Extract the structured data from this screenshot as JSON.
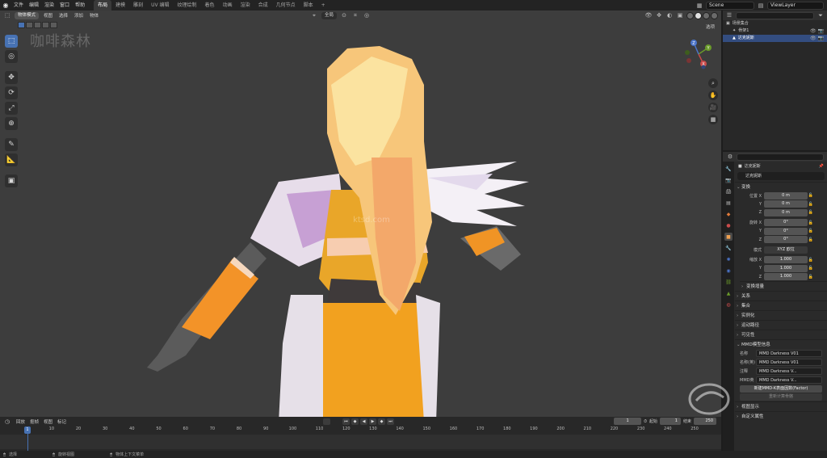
{
  "topbar": {
    "menu": [
      "文件",
      "编辑",
      "渲染",
      "窗口",
      "帮助"
    ],
    "tabs": [
      "布局",
      "建模",
      "雕刻",
      "UV 编辑",
      "纹理绘制",
      "着色",
      "动画",
      "渲染",
      "合成",
      "几何节点",
      "脚本"
    ],
    "active_tab_index": 0,
    "plus": "+",
    "scene": "Scene",
    "view_layer": "ViewLayer"
  },
  "viewport": {
    "mode": "物体模式",
    "menus": [
      "视图",
      "选择",
      "添加",
      "物体"
    ],
    "transform_orientation": "全局",
    "options": "选项",
    "watermark": "咖啡森林",
    "center_watermark": "ktsd.com"
  },
  "toolbar": {
    "tools": [
      "select-box",
      "cursor",
      "move",
      "rotate",
      "scale",
      "transform",
      "annotate",
      "measure",
      "add-cube"
    ]
  },
  "gizmo": {
    "x": "X",
    "y": "Y",
    "z": "Z"
  },
  "outliner": {
    "root": "场景集合",
    "rows": [
      {
        "label": "骨架1",
        "sel": false
      },
      {
        "label": "达克妮斯",
        "sel": true
      }
    ]
  },
  "properties": {
    "object_name": "达克妮斯",
    "data_name": "达克妮斯",
    "transform_title": "变换",
    "location_label": "位置 X",
    "loc": {
      "x": "0 m",
      "y": "0 m",
      "z": "0 m"
    },
    "rotation_label": "旋转 X",
    "rot": {
      "x": "0°",
      "y": "0°",
      "z": "0°"
    },
    "mode_label": "模式",
    "mode_value": "XYZ 欧拉",
    "scale_label": "缩放 X",
    "scale": {
      "x": "1.000",
      "y": "1.000",
      "z": "1.000"
    },
    "delta": "变换增量",
    "axis": {
      "y": "Y",
      "z": "Z"
    },
    "sections": [
      "关系",
      "集合",
      "实例化",
      "运动路径",
      "可见性"
    ],
    "mmd_title": "MMD模型信息",
    "mmd": [
      {
        "k": "名称",
        "v": "MMD Darkness V01"
      },
      {
        "k": "名称(英)",
        "v": "MMD Darkness V01"
      },
      {
        "k": "注释",
        "v": "MMD Darkness V..."
      },
      {
        "k": "MMD英",
        "v": "MMD Darkness V..."
      }
    ],
    "mmd_btn": "新建MMD-K表面因数(Factor)",
    "mmd_btn2": "重新计算骨骼",
    "bottom_sections": [
      "视图显示",
      "自定义属性"
    ]
  },
  "timeline": {
    "menus": [
      "回放",
      "抠帧",
      "视图",
      "标记"
    ],
    "current": "1",
    "start_label": "起始",
    "start": "1",
    "end_label": "结束",
    "end": "250",
    "ticks": [
      "1",
      "10",
      "20",
      "30",
      "40",
      "50",
      "60",
      "70",
      "80",
      "90",
      "100",
      "110",
      "120",
      "130",
      "140",
      "150",
      "160",
      "170",
      "180",
      "190",
      "200",
      "210",
      "220",
      "230",
      "240",
      "250"
    ]
  },
  "statusbar": {
    "select": "选择",
    "rotate": "旋转视图",
    "menu": "物体上下文菜单"
  },
  "colors": {
    "accent": "#4772b3",
    "panel": "#282828",
    "viewport": "#3d3d3d"
  }
}
